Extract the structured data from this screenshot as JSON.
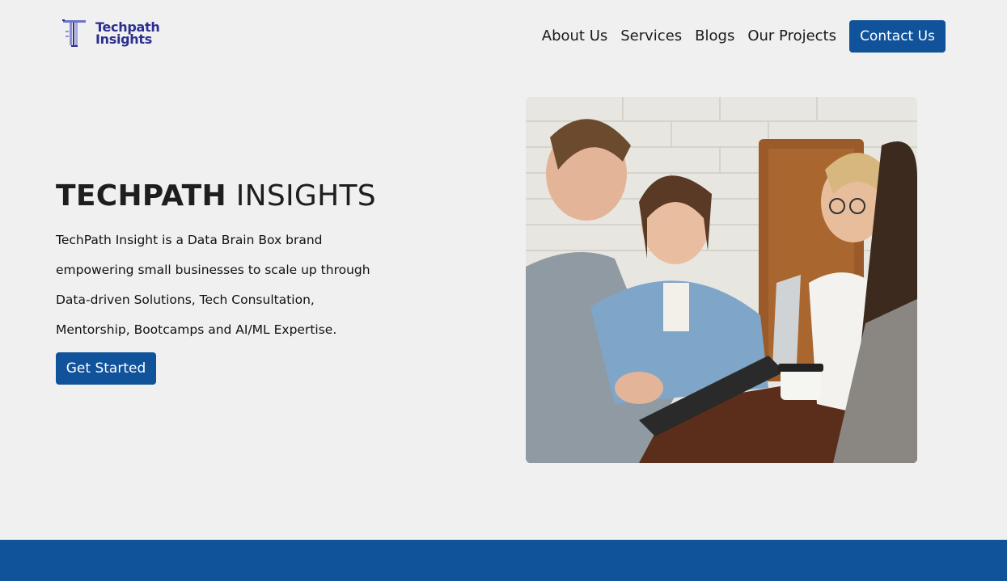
{
  "brand": {
    "name_line1": "Techpath",
    "name_line2": "Insights",
    "color": "#2b2f8f"
  },
  "nav": {
    "links": [
      "About Us",
      "Services",
      "Blogs",
      "Our Projects"
    ],
    "contact_label": "Contact Us"
  },
  "hero": {
    "title_bold": "TECHPATH",
    "title_light": "INSIGHTS",
    "description": "TechPath Insight is a Data Brain Box brand empowering small businesses to scale up through Data-driven Solutions, Tech Consultation, Mentorship, Bootcamps and AI/ML Expertise.",
    "cta_label": "Get Started"
  },
  "colors": {
    "accent": "#11539a",
    "background": "#f0f0f0",
    "text": "#1e1e1e"
  }
}
